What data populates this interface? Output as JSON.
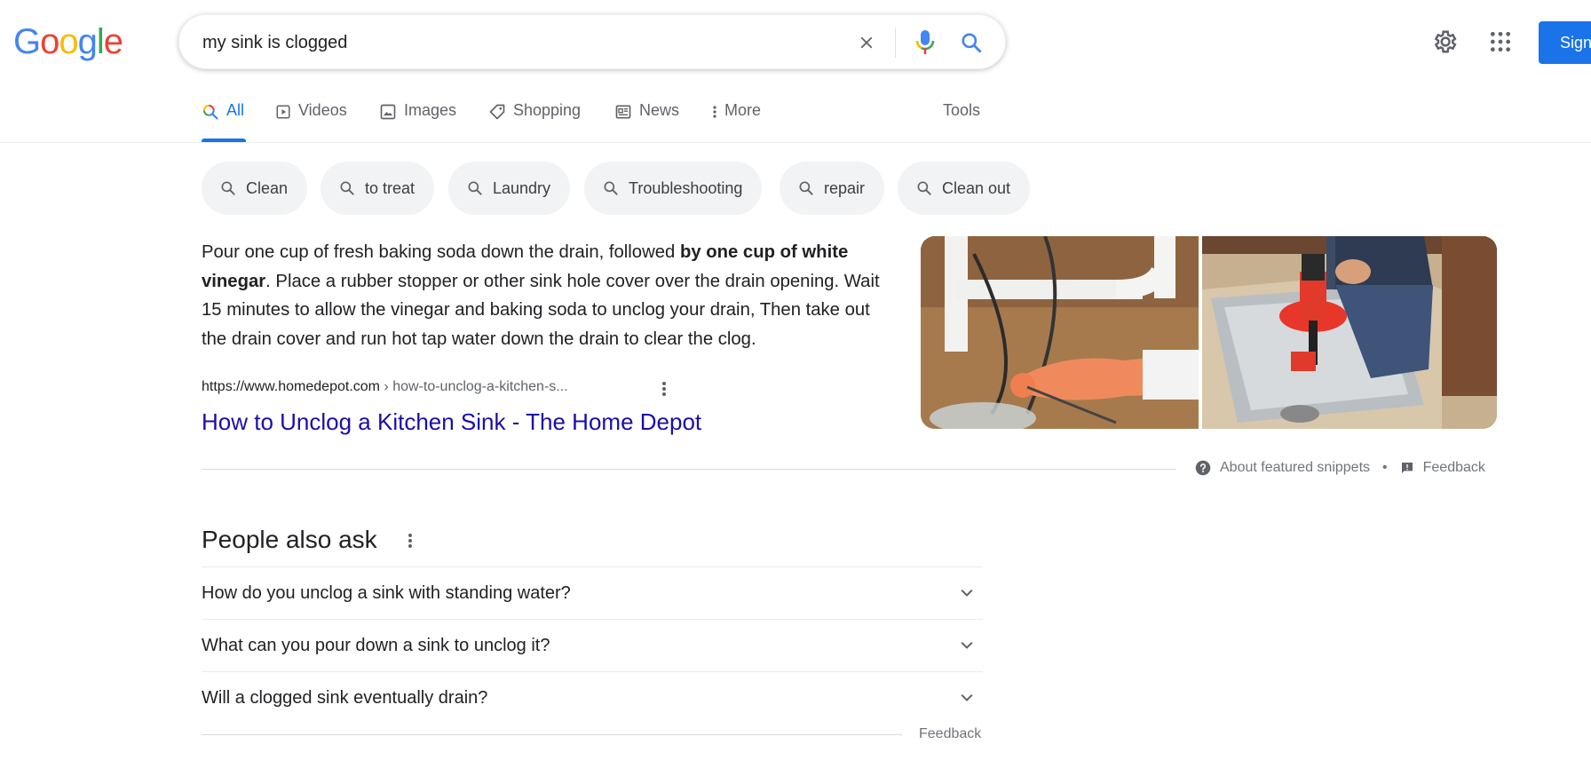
{
  "logo": {
    "letters": [
      "G",
      "o",
      "o",
      "g",
      "l",
      "e"
    ],
    "colors": [
      "#4285F4",
      "#EA4335",
      "#FBBC05",
      "#4285F4",
      "#34A853",
      "#EA4335"
    ]
  },
  "search": {
    "query": "my sink is clogged"
  },
  "header": {
    "sign_in_label": "Sign"
  },
  "tabs": [
    {
      "label": "All",
      "icon": "search-color-icon",
      "active": true
    },
    {
      "label": "Videos",
      "icon": "video-icon"
    },
    {
      "label": "Images",
      "icon": "image-icon"
    },
    {
      "label": "Shopping",
      "icon": "tag-icon"
    },
    {
      "label": "News",
      "icon": "news-icon"
    },
    {
      "label": "More",
      "icon": "more-vert-icon"
    },
    {
      "label": "Tools"
    }
  ],
  "chips": [
    "Clean",
    "to treat",
    "Laundry",
    "Troubleshooting",
    "repair",
    "Clean out"
  ],
  "snippet": {
    "text_before": "Pour one cup of fresh baking soda down the drain, followed ",
    "text_bold": "by one cup of white vinegar",
    "text_after": ". Place a rubber stopper or other sink hole cover over the drain opening. Wait 15 minutes to allow the vinegar and baking soda to unclog your drain, Then take out the drain cover and run hot tap water down the drain to clear the clog.",
    "source_domain": "https://www.homedepot.com",
    "source_path": " › how-to-unclog-a-kitchen-s...",
    "title": "How to Unclog a Kitchen Sink - The Home Depot",
    "about_label": "About featured snippets",
    "feedback_label": "Feedback"
  },
  "paa": {
    "title": "People also ask",
    "questions": [
      "How do you unclog a sink with standing water?",
      "What can you pour down a sink to unclog it?",
      "Will a clogged sink eventually drain?"
    ],
    "feedback_label": "Feedback"
  },
  "colors": {
    "accent": "#1a73e8",
    "link": "#1a0dab"
  }
}
